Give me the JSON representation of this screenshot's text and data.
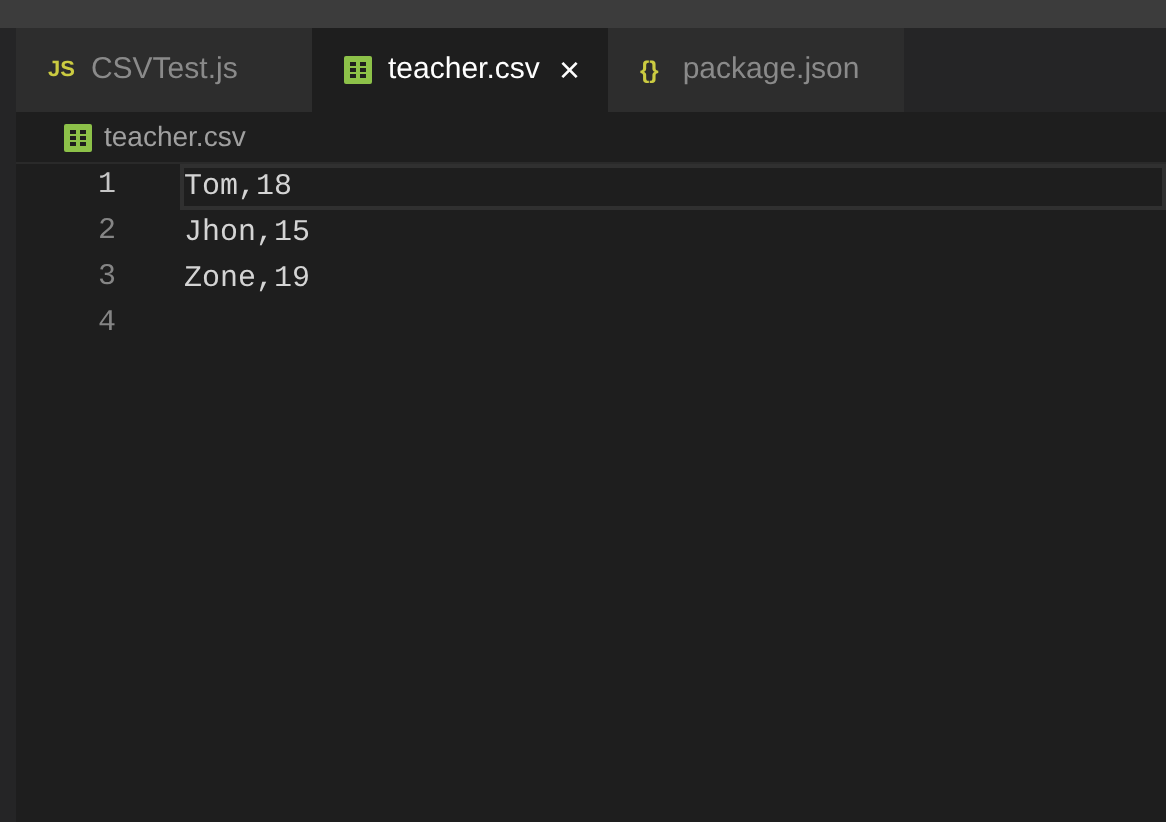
{
  "tabs": [
    {
      "label": "CSVTest.js",
      "icon": "JS",
      "kind": "js",
      "selected": false
    },
    {
      "label": "teacher.csv",
      "kind": "csv",
      "selected": true,
      "close": "×"
    },
    {
      "label": "package.json",
      "icon": "{}",
      "kind": "json",
      "selected": false
    }
  ],
  "breadcrumb": {
    "label": "teacher.csv",
    "kind": "csv"
  },
  "editor": {
    "lines": [
      {
        "number": "1",
        "text": "Tom,18",
        "current": true
      },
      {
        "number": "2",
        "text": "Jhon,15",
        "current": false
      },
      {
        "number": "3",
        "text": "Zone,19",
        "current": false
      },
      {
        "number": "4",
        "current": false
      }
    ]
  }
}
